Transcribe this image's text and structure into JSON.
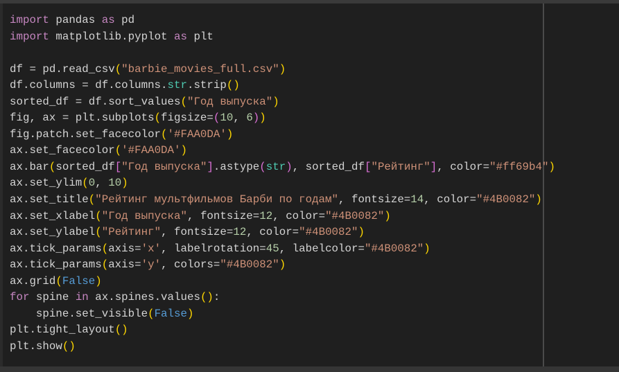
{
  "editor": {
    "lines": [
      [
        [
          "kw",
          "import"
        ],
        [
          "id",
          " pandas "
        ],
        [
          "kw",
          "as"
        ],
        [
          "id",
          " pd"
        ]
      ],
      [
        [
          "kw",
          "import"
        ],
        [
          "id",
          " matplotlib.pyplot "
        ],
        [
          "kw",
          "as"
        ],
        [
          "id",
          " plt"
        ]
      ],
      [],
      [
        [
          "id",
          "df = pd.read_csv"
        ],
        [
          "br1",
          "("
        ],
        [
          "str",
          "\"barbie_movies_full.csv\""
        ],
        [
          "br1",
          ")"
        ]
      ],
      [
        [
          "id",
          "df.columns = df.columns."
        ],
        [
          "cls",
          "str"
        ],
        [
          "id",
          ".strip"
        ],
        [
          "br1",
          "()"
        ]
      ],
      [
        [
          "id",
          "sorted_df = df.sort_values"
        ],
        [
          "br1",
          "("
        ],
        [
          "str",
          "\"Год выпуска\""
        ],
        [
          "br1",
          ")"
        ]
      ],
      [
        [
          "id",
          "fig, ax = plt.subplots"
        ],
        [
          "br1",
          "("
        ],
        [
          "id",
          "figsize="
        ],
        [
          "br2",
          "("
        ],
        [
          "num",
          "10"
        ],
        [
          "id",
          ", "
        ],
        [
          "num",
          "6"
        ],
        [
          "br2",
          ")"
        ],
        [
          "br1",
          ")"
        ]
      ],
      [
        [
          "id",
          "fig.patch.set_facecolor"
        ],
        [
          "br1",
          "("
        ],
        [
          "str",
          "'#FAA0DA'"
        ],
        [
          "br1",
          ")"
        ]
      ],
      [
        [
          "id",
          "ax.set_facecolor"
        ],
        [
          "br1",
          "("
        ],
        [
          "str",
          "'#FAA0DA'"
        ],
        [
          "br1",
          ")"
        ]
      ],
      [
        [
          "id",
          "ax.bar"
        ],
        [
          "br1",
          "("
        ],
        [
          "id",
          "sorted_df"
        ],
        [
          "br2",
          "["
        ],
        [
          "str",
          "\"Год выпуска\""
        ],
        [
          "br2",
          "]"
        ],
        [
          "id",
          ".astype"
        ],
        [
          "br2",
          "("
        ],
        [
          "cls",
          "str"
        ],
        [
          "br2",
          ")"
        ],
        [
          "id",
          ", sorted_df"
        ],
        [
          "br2",
          "["
        ],
        [
          "str",
          "\"Рейтинг\""
        ],
        [
          "br2",
          "]"
        ],
        [
          "id",
          ", color="
        ],
        [
          "str",
          "\"#ff69b4\""
        ],
        [
          "br1",
          ")"
        ]
      ],
      [
        [
          "id",
          "ax.set_ylim"
        ],
        [
          "br1",
          "("
        ],
        [
          "num",
          "0"
        ],
        [
          "id",
          ", "
        ],
        [
          "num",
          "10"
        ],
        [
          "br1",
          ")"
        ]
      ],
      [
        [
          "id",
          "ax.set_title"
        ],
        [
          "br1",
          "("
        ],
        [
          "str",
          "\"Рейтинг мультфильмов Барби по годам\""
        ],
        [
          "id",
          ", fontsize="
        ],
        [
          "num",
          "14"
        ],
        [
          "id",
          ", color="
        ],
        [
          "str",
          "\"#4B0082\""
        ],
        [
          "br1",
          ")"
        ]
      ],
      [
        [
          "id",
          "ax.set_xlabel"
        ],
        [
          "br1",
          "("
        ],
        [
          "str",
          "\"Год выпуска\""
        ],
        [
          "id",
          ", fontsize="
        ],
        [
          "num",
          "12"
        ],
        [
          "id",
          ", color="
        ],
        [
          "str",
          "\"#4B0082\""
        ],
        [
          "br1",
          ")"
        ]
      ],
      [
        [
          "id",
          "ax.set_ylabel"
        ],
        [
          "br1",
          "("
        ],
        [
          "str",
          "\"Рейтинг\""
        ],
        [
          "id",
          ", fontsize="
        ],
        [
          "num",
          "12"
        ],
        [
          "id",
          ", color="
        ],
        [
          "str",
          "\"#4B0082\""
        ],
        [
          "br1",
          ")"
        ]
      ],
      [
        [
          "id",
          "ax.tick_params"
        ],
        [
          "br1",
          "("
        ],
        [
          "id",
          "axis="
        ],
        [
          "str",
          "'x'"
        ],
        [
          "id",
          ", labelrotation="
        ],
        [
          "num",
          "45"
        ],
        [
          "id",
          ", labelcolor="
        ],
        [
          "str",
          "\"#4B0082\""
        ],
        [
          "br1",
          ")"
        ]
      ],
      [
        [
          "id",
          "ax.tick_params"
        ],
        [
          "br1",
          "("
        ],
        [
          "id",
          "axis="
        ],
        [
          "str",
          "'y'"
        ],
        [
          "id",
          ", colors="
        ],
        [
          "str",
          "\"#4B0082\""
        ],
        [
          "br1",
          ")"
        ]
      ],
      [
        [
          "id",
          "ax.grid"
        ],
        [
          "br1",
          "("
        ],
        [
          "const",
          "False"
        ],
        [
          "br1",
          ")"
        ]
      ],
      [
        [
          "kw",
          "for"
        ],
        [
          "id",
          " spine "
        ],
        [
          "kw",
          "in"
        ],
        [
          "id",
          " ax.spines.values"
        ],
        [
          "br1",
          "()"
        ],
        [
          "id",
          ":"
        ]
      ],
      [
        [
          "id",
          "    spine.set_visible"
        ],
        [
          "br1",
          "("
        ],
        [
          "const",
          "False"
        ],
        [
          "br1",
          ")"
        ]
      ],
      [
        [
          "id",
          "plt.tight_layout"
        ],
        [
          "br1",
          "()"
        ]
      ],
      [
        [
          "id",
          "plt.show"
        ],
        [
          "br1",
          "()"
        ]
      ]
    ]
  }
}
